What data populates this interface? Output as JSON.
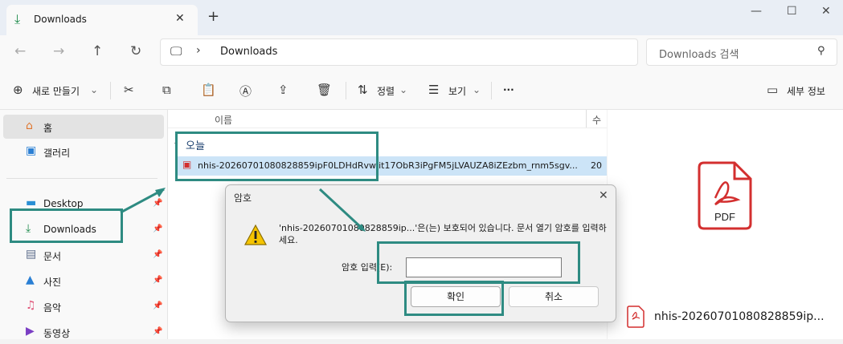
{
  "titlebar": {
    "tab_title": "Downloads",
    "tab_icon": "download-icon",
    "new_tab": "+",
    "minimize": "—",
    "maximize": "☐",
    "close": "✕"
  },
  "address": {
    "breadcrumb": "Downloads",
    "search_placeholder": "Downloads 검색"
  },
  "toolbar": {
    "new_label": "새로 만들기",
    "sort_label": "정렬",
    "view_label": "보기",
    "more_label": "···",
    "details_label": "세부 정보"
  },
  "sidebar": {
    "items": [
      {
        "label": "홈",
        "icon": "home-icon"
      },
      {
        "label": "갤러리",
        "icon": "gallery-icon"
      },
      {
        "label": "Desktop",
        "icon": "desktop-icon"
      },
      {
        "label": "Downloads",
        "icon": "download-icon"
      },
      {
        "label": "문서",
        "icon": "document-icon"
      },
      {
        "label": "사진",
        "icon": "pictures-icon"
      },
      {
        "label": "음악",
        "icon": "music-icon"
      },
      {
        "label": "동영상",
        "icon": "video-icon"
      }
    ]
  },
  "content": {
    "column_name": "이름",
    "column_modified": "수",
    "group_label": "오늘",
    "file_name": "nhis-20260701080828859ipF0LDHdRvwlit17ObR3iPgFM5jLVAUZA8iZEzbm_rnm5sgv...",
    "file_date": "20"
  },
  "preview": {
    "file_name": "nhis-20260701080828859ip...",
    "badge": "PDF"
  },
  "dialog": {
    "title": "암호",
    "message": "'nhis-20260701080828859ip...'은(는) 보호되어 있습니다. 문서 열기 암호를 입력하세요.",
    "password_label": "암호 입력(E):",
    "password_value": "",
    "ok_label": "확인",
    "cancel_label": "취소"
  },
  "colors": {
    "annotation": "#2e8b82",
    "selection": "#cce4f7",
    "pdf_red": "#d32f2f",
    "download_green": "#1d8a4a"
  }
}
